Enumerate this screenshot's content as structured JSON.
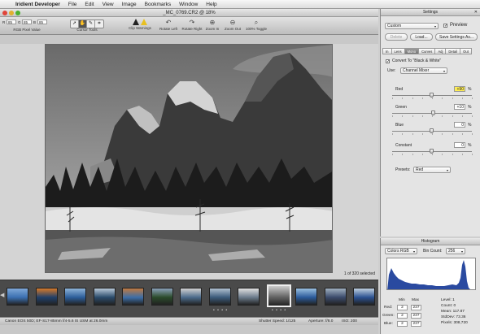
{
  "menubar": {
    "app_name": "Iridient Developer",
    "items": [
      "File",
      "Edit",
      "View",
      "Image",
      "Bookmarks",
      "Window",
      "Help"
    ]
  },
  "window": {
    "title": "_MC_0769.CR2 @ 18%"
  },
  "toolbar": {
    "rgb": {
      "r_label": "R",
      "r_value": "85",
      "g_label": "G",
      "g_value": "85",
      "b_label": "B",
      "b_value": "85",
      "caption": "RGB Pixel Value"
    },
    "cursor_tools_label": "Cursor Tools",
    "clip_warnings_label": "Clip Warnings",
    "rotate_left_label": "Rotate Left",
    "rotate_right_label": "Rotate Right",
    "zoom_in_label": "Zoom In",
    "zoom_out_label": "Zoom Out",
    "toggle_label": "100% Toggle"
  },
  "viewer": {
    "selection_status": "1 of 320 selected"
  },
  "filmstrip": {
    "selected_index": 9,
    "dots": "• • • •"
  },
  "statusbar": {
    "camera": "Canon EOS 50D; EF-S17-85mm f/4-5.6 IS USM at 26.0mm",
    "shutter": "Shutter Speed: 1/125",
    "aperture": "Aperture: f/8.0",
    "iso": "ISO: 200"
  },
  "settings": {
    "title": "Settings",
    "preset": "Custom",
    "preview_label": "Preview",
    "preview_checked": true,
    "delete_label": "Delete",
    "load_label": "Load...",
    "save_label": "Save Settings As...",
    "tabs": [
      "In",
      "Lens",
      "Mono",
      "Curves",
      "Adj",
      "Detail",
      "Out"
    ],
    "active_tab": "Mono",
    "convert_label": "Convert To \"Black & White\"",
    "convert_checked": true,
    "use_label": "Use:",
    "use_value": "Channel Mixer",
    "sliders": [
      {
        "label": "Red",
        "value": "+90",
        "highlight": true,
        "fraction": 0.5
      },
      {
        "label": "Green",
        "value": "+10",
        "highlight": false,
        "fraction": 0.52
      },
      {
        "label": "Blue",
        "value": "0",
        "highlight": false,
        "fraction": 0.5
      },
      {
        "label": "Constant",
        "value": "0",
        "highlight": false,
        "fraction": 0.5
      }
    ],
    "unit": "%",
    "presets_label": "Presets:",
    "presets_value": "Red"
  },
  "histogram": {
    "title": "Histogram",
    "mode": "Colors RGB",
    "bin_label": "Bin Count:",
    "bin_value": "256",
    "min_header": "Min",
    "max_header": "Max",
    "rows": [
      {
        "label": "Red:",
        "min": "2",
        "max": "237"
      },
      {
        "label": "Green:",
        "min": "2",
        "max": "237"
      },
      {
        "label": "Blue:",
        "min": "2",
        "max": "237"
      }
    ],
    "stats": [
      "Level: 1",
      "Count: 0",
      "Mean: 117.87",
      "StdDev: 73.36",
      "Pixels: 308,720"
    ]
  },
  "colors": {
    "histogram_fill": "#2a4aa0",
    "highlight": "#ffee55"
  }
}
